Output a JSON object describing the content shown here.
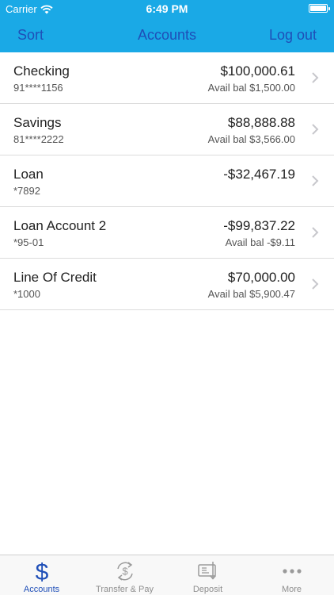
{
  "status": {
    "carrier": "Carrier",
    "time": "6:49 PM"
  },
  "nav": {
    "sort_label": "Sort",
    "title": "Accounts",
    "logout_label": "Log out"
  },
  "accounts": [
    {
      "name": "Checking",
      "number": "91****1156",
      "balance": "$100,000.61",
      "avail": "Avail bal $1,500.00"
    },
    {
      "name": "Savings",
      "number": "81****2222",
      "balance": "$88,888.88",
      "avail": "Avail bal $3,566.00"
    },
    {
      "name": "Loan",
      "number": "*7892",
      "balance": "-$32,467.19",
      "avail": ""
    },
    {
      "name": "Loan Account 2",
      "number": "*95-01",
      "balance": "-$99,837.22",
      "avail": "Avail bal -$9.11"
    },
    {
      "name": "Line Of Credit",
      "number": "*1000",
      "balance": "$70,000.00",
      "avail": "Avail bal $5,900.47"
    }
  ],
  "tabs": [
    {
      "label": "Accounts",
      "icon": "dollar-icon",
      "active": true
    },
    {
      "label": "Transfer & Pay",
      "icon": "transfer-icon",
      "active": false
    },
    {
      "label": "Deposit",
      "icon": "check-deposit-icon",
      "active": false
    },
    {
      "label": "More",
      "icon": "more-dots-icon",
      "active": false
    }
  ],
  "colors": {
    "header": "#1aa9e6",
    "accent": "#1f4fb8",
    "tab_inactive": "#8e8e8e"
  }
}
